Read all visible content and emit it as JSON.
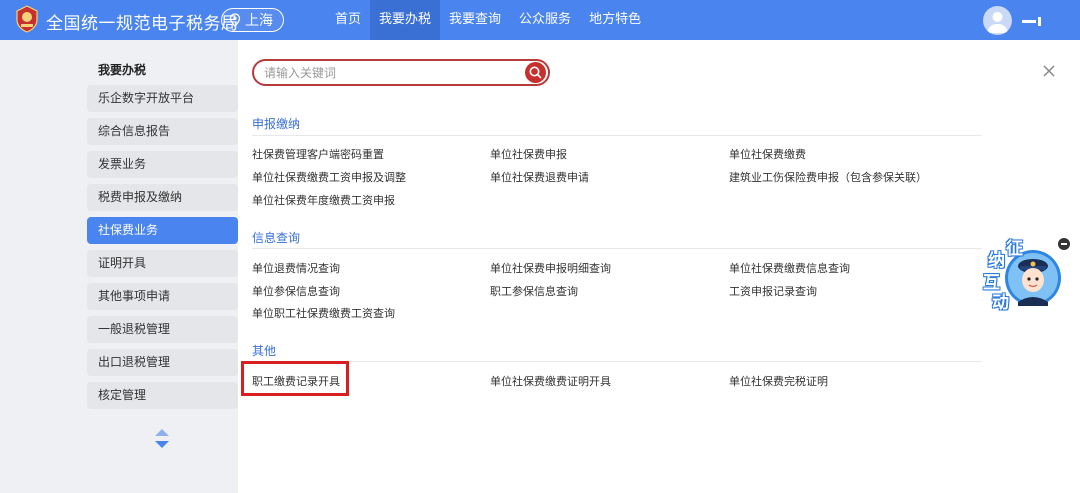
{
  "header": {
    "site_title": "全国统一规范电子税务局",
    "city": "上海",
    "nav": [
      "首页",
      "我要办税",
      "我要查询",
      "公众服务",
      "地方特色"
    ],
    "active_nav_index": 1
  },
  "sidebar": {
    "heading": "我要办税",
    "items": [
      "乐企数字开放平台",
      "综合信息报告",
      "发票业务",
      "税费申报及缴纳",
      "社保费业务",
      "证明开具",
      "其他事项申请",
      "一般退税管理",
      "出口退税管理",
      "核定管理"
    ],
    "active_index": 4
  },
  "search": {
    "placeholder": "请输入关键词",
    "value": ""
  },
  "sections": [
    {
      "title": "申报缴纳",
      "links": [
        "社保费管理客户端密码重置",
        "单位社保费申报",
        "单位社保费缴费",
        "单位社保费缴费工资申报及调整",
        "单位社保费退费申请",
        "建筑业工伤保险费申报（包含参保关联）",
        "单位社保费年度缴费工资申报"
      ]
    },
    {
      "title": "信息查询",
      "links": [
        "单位退费情况查询",
        "单位社保费申报明细查询",
        "单位社保费缴费信息查询",
        "单位参保信息查询",
        "职工参保信息查询",
        "工资申报记录查询",
        "单位职工社保费缴费工资查询"
      ]
    },
    {
      "title": "其他",
      "links": [
        "职工缴费记录开具",
        "单位社保费缴费证明开具",
        "单位社保费完税证明"
      ]
    }
  ],
  "assistant": {
    "chars": [
      "征",
      "纳",
      "互",
      "动"
    ]
  },
  "colors": {
    "header_bg": "#4a84ee",
    "active": "#4a84ee",
    "section_title": "#3a6fd4",
    "highlight": "#d81e1e"
  }
}
